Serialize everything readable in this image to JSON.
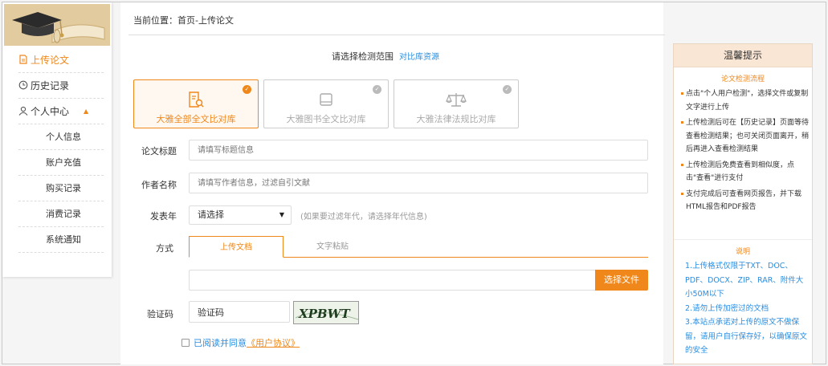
{
  "sidebar": {
    "items": [
      {
        "label": "上传论文",
        "icon": "document-icon",
        "active": true
      },
      {
        "label": "历史记录",
        "icon": "clock-icon",
        "active": false
      },
      {
        "label": "个人中心",
        "icon": "user-icon",
        "active": false
      }
    ],
    "caret": "▲",
    "sub_items": [
      "个人信息",
      "账户充值",
      "购买记录",
      "消费记录",
      "系统通知"
    ]
  },
  "breadcrumb": "当前位置：首页-上传论文",
  "scope": {
    "title": "请选择检测范围",
    "link": "对比库资源"
  },
  "databases": [
    {
      "label": "大雅全部全文比对库",
      "icon": "document-search-icon",
      "selected": true
    },
    {
      "label": "大雅图书全文比对库",
      "icon": "book-icon",
      "selected": false
    },
    {
      "label": "大雅法律法规比对库",
      "icon": "scales-icon",
      "selected": false
    }
  ],
  "form": {
    "title_label": "论文标题",
    "title_placeholder": "请填写标题信息",
    "author_label": "作者名称",
    "author_placeholder": "请填写作者信息，过滤自引文献",
    "year_label": "发表年",
    "year_value": "请选择",
    "year_arrow": "▼",
    "year_hint": "(如果要过滤年代，请选择年代信息)",
    "method_label": "方式",
    "tabs": [
      "上传文档",
      "文字粘贴"
    ],
    "file_button": "选择文件",
    "captcha_label": "验证码",
    "captcha_value": "验证码",
    "captcha_text": "XPBWT",
    "agree_text": "已阅读并同意",
    "agree_link": "《用户协议》"
  },
  "tips": {
    "title": "温馨提示",
    "process_title": "论文检测流程",
    "steps": [
      "点击\"个人用户检测\"，选择文件或复制文字进行上传",
      "上传检测后可在【历史记录】页面等待查看检测结果；也可关闭页面离开，稍后再进入查看检测结果",
      "上传检测后免费查看到相似度，点击\"查看\"进行支付",
      "支付完成后可查看网页报告，并下载HTML报告和PDF报告"
    ],
    "notes_title": "说明",
    "notes": [
      "1.上传格式仅限于TXT、DOC、PDF、DOCX、ZIP、RAR、附件大小50M以下",
      "2.请勿上传加密过的文档",
      "3.本站点承诺对上传的原文不做保留，请用户自行保存好，以确保原文的安全"
    ]
  },
  "colors": {
    "accent": "#f0871b",
    "link": "#2a8de0"
  }
}
